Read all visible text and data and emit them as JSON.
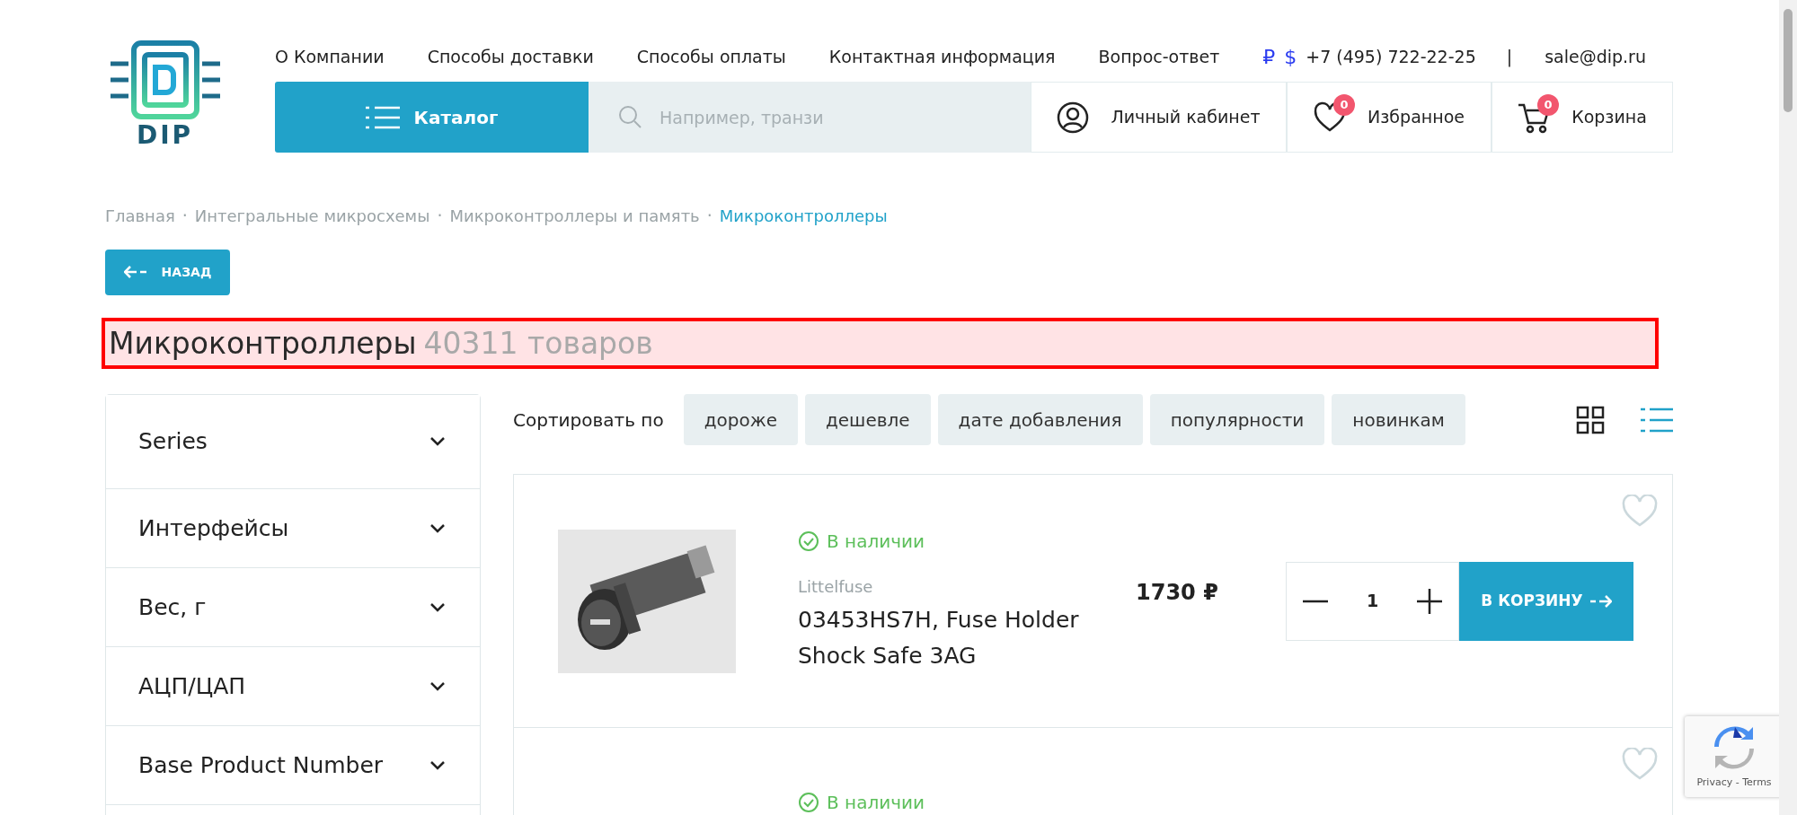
{
  "logo": {
    "text": "DIP"
  },
  "top_nav": [
    "О Компании",
    "Способы доставки",
    "Способы оплаты",
    "Контактная информация",
    "Вопрос-ответ"
  ],
  "contacts": {
    "currencies": [
      "₽",
      "$"
    ],
    "phone": "+7 (495) 722-22-25",
    "separator": "|",
    "email": "sale@dip.ru"
  },
  "catalog_button": "Каталог",
  "search": {
    "placeholder": "Например, транзи"
  },
  "account": [
    {
      "kind": "user",
      "label": "Личный кабинет"
    },
    {
      "kind": "heart",
      "label": "Избранное",
      "badge": "0"
    },
    {
      "kind": "cart",
      "label": "Корзина",
      "badge": "0"
    }
  ],
  "breadcrumbs": [
    {
      "label": "Главная",
      "current": false
    },
    {
      "separator": "·",
      "label": "Интегральные микросхемы",
      "current": false
    },
    {
      "separator": "·",
      "label": "Микроконтроллеры и память",
      "current": false
    },
    {
      "separator": "·",
      "label": "Микроконтроллеры",
      "current": true
    }
  ],
  "back_button": "НАЗАД",
  "heading": {
    "title": "Микроконтроллеры",
    "count": "40311 товаров",
    "highlighted": true
  },
  "filters": [
    {
      "label": "Series",
      "expanded": false
    },
    {
      "label": "Интерфейсы",
      "expanded": false
    },
    {
      "label": "Вес, г",
      "expanded": false
    },
    {
      "label": "АЦП/ЦАП",
      "expanded": false
    },
    {
      "label": "Base Product Number",
      "expanded": false
    }
  ],
  "sort": {
    "label": "Сортировать по",
    "options": [
      {
        "label": "дороже",
        "selected": false
      },
      {
        "label": "дешевле",
        "selected": false
      },
      {
        "label": "дате добавления",
        "selected": false
      },
      {
        "label": "популярности",
        "selected": false
      },
      {
        "label": "новинкам",
        "selected": false
      }
    ]
  },
  "view_modes": [
    {
      "kind": "grid",
      "selected": false
    },
    {
      "kind": "list",
      "selected": true
    }
  ],
  "products": [
    {
      "stock": "В наличии",
      "in_stock": true,
      "brand": "Littelfuse",
      "name": "03453HS7H, Fuse Holder Shock Safe 3AG",
      "price": "1730 ₽",
      "quantity": "1",
      "cart_button": "В КОРЗИНУ",
      "favorite": false
    },
    {
      "stock": "В наличии",
      "in_stock": true,
      "favorite": false
    }
  ],
  "recaptcha": {
    "text": "Privacy - Terms"
  }
}
